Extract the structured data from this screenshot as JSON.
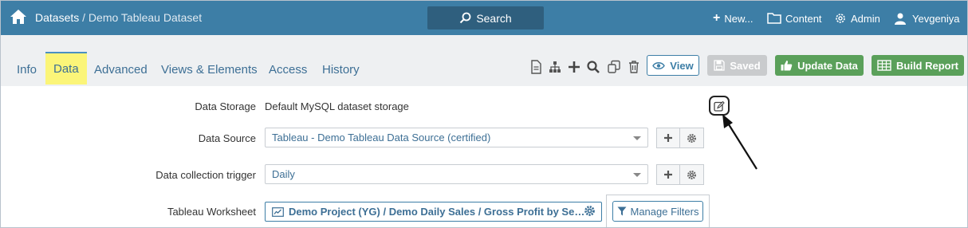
{
  "header": {
    "breadcrumb_link": "Datasets",
    "breadcrumb_separator": " / ",
    "breadcrumb_current": "Demo Tableau Dataset",
    "search_label": "Search",
    "new_label": "New...",
    "content_label": "Content",
    "admin_label": "Admin",
    "user_label": "Yevgeniya"
  },
  "tabs": [
    {
      "label": "Info",
      "active": false
    },
    {
      "label": "Data",
      "active": true
    },
    {
      "label": "Advanced",
      "active": false
    },
    {
      "label": "Views & Elements",
      "active": false
    },
    {
      "label": "Access",
      "active": false
    },
    {
      "label": "History",
      "active": false
    }
  ],
  "toolbar": {
    "icons": [
      "document-icon",
      "hierarchy-icon",
      "plus-icon",
      "search-icon",
      "copy-icon",
      "trash-icon"
    ],
    "view_label": "View",
    "saved_label": "Saved",
    "update_label": "Update Data",
    "build_label": "Build Report"
  },
  "form": {
    "storage_label": "Data Storage",
    "storage_value": "Default MySQL dataset storage",
    "source_label": "Data Source",
    "source_value": "Tableau - Demo Tableau Data Source (certified)",
    "trigger_label": "Data collection trigger",
    "trigger_value": "Daily",
    "worksheet_label": "Tableau Worksheet",
    "worksheet_value": "Demo Project (YG) / Demo Daily Sales / Gross Profit by Segment",
    "manage_filters_label": "Manage Filters"
  },
  "colors": {
    "topbar": "#3d7ea6",
    "active_tab_highlight": "#fbf579",
    "success_button": "#5aa05a",
    "disabled_button": "#c9cbcd"
  }
}
